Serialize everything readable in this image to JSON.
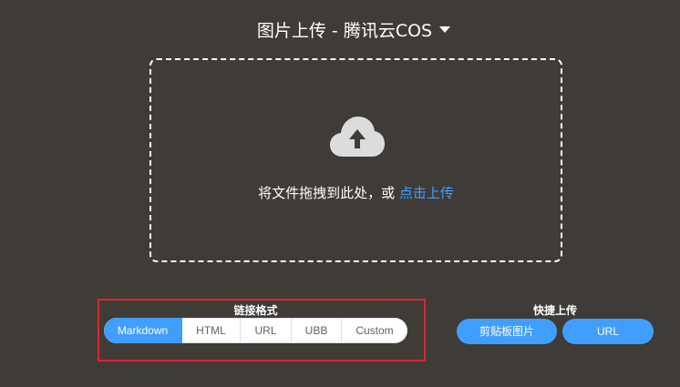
{
  "header": {
    "title": "图片上传 - 腾讯云COS"
  },
  "dropzone": {
    "text": "将文件拖拽到此处，或 ",
    "link": "点击上传"
  },
  "link_format": {
    "label": "链接格式",
    "options": [
      "Markdown",
      "HTML",
      "URL",
      "UBB",
      "Custom"
    ],
    "selected": "Markdown"
  },
  "quick_upload": {
    "label": "快捷上传",
    "clipboard_button": "剪贴板图片",
    "url_button": "URL"
  },
  "colors": {
    "background": "#3f3b37",
    "accent": "#409eff",
    "highlight": "#e0242b"
  }
}
